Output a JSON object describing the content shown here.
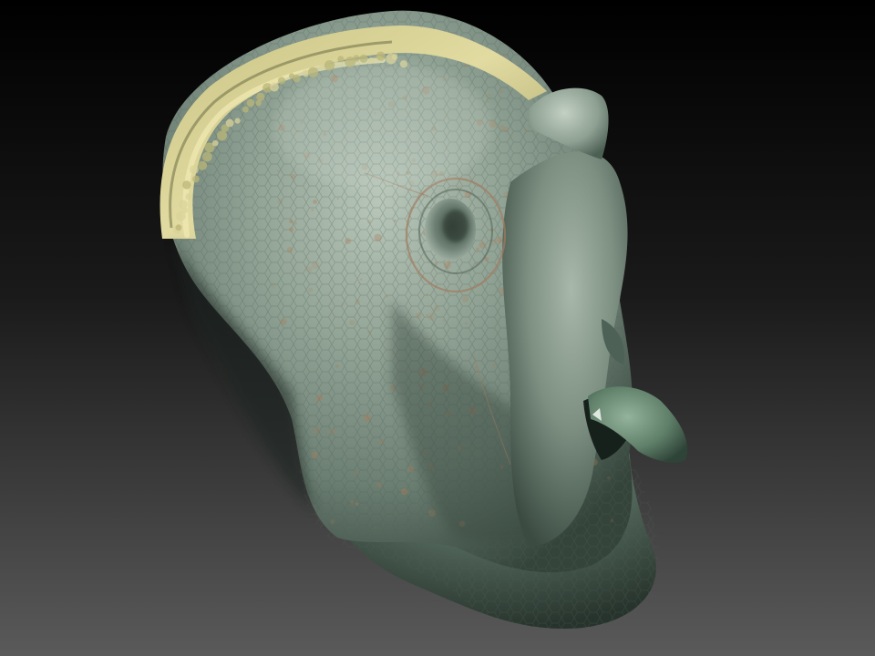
{
  "render": {
    "subject": "creature-head-sculpt",
    "background": {
      "top_color": "#000000",
      "bottom_color": "#5a5a5a"
    },
    "palette": {
      "skin_base": "#6f8479",
      "skin_highlight": "#a8b9ac",
      "skin_shadow": "#2c3a33",
      "crest": "#b9b677",
      "crest_highlight": "#d9d39a",
      "speckle": "#b07c56",
      "tongue": "#6d8f76",
      "ear_ring": "#a37a5f"
    }
  }
}
